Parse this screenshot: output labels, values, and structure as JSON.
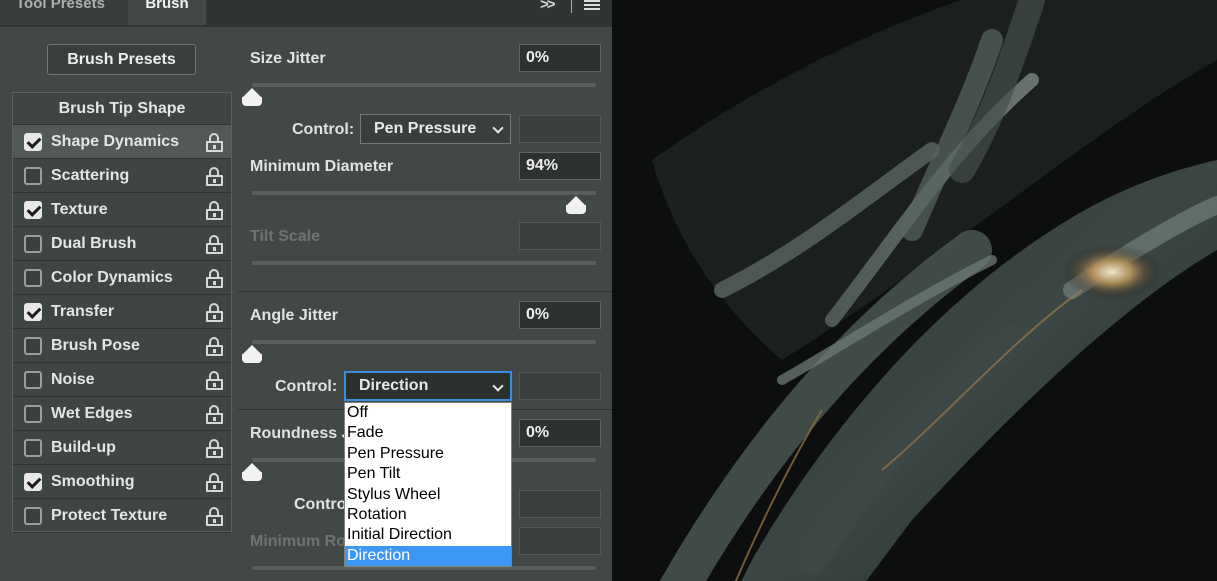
{
  "tabs": {
    "tool_presets": "Tool Presets",
    "brush": "Brush"
  },
  "panel": {
    "collapse_glyph": ">>",
    "brush_presets_label": "Brush Presets"
  },
  "sidebar": {
    "header": "Brush Tip Shape",
    "items": [
      {
        "label": "Shape Dynamics",
        "checked": true,
        "active": true
      },
      {
        "label": "Scattering",
        "checked": false
      },
      {
        "label": "Texture",
        "checked": true
      },
      {
        "label": "Dual Brush",
        "checked": false
      },
      {
        "label": "Color Dynamics",
        "checked": false
      },
      {
        "label": "Transfer",
        "checked": true
      },
      {
        "label": "Brush Pose",
        "checked": false
      },
      {
        "label": "Noise",
        "checked": false
      },
      {
        "label": "Wet Edges",
        "checked": false
      },
      {
        "label": "Build-up",
        "checked": false
      },
      {
        "label": "Smoothing",
        "checked": true
      },
      {
        "label": "Protect Texture",
        "checked": false
      }
    ]
  },
  "settings": {
    "size_jitter": {
      "label": "Size Jitter",
      "value": "0%",
      "level": 0
    },
    "size_control": {
      "label": "Control:",
      "value": "Pen Pressure"
    },
    "min_diameter": {
      "label": "Minimum Diameter",
      "value": "94%",
      "level": 0.94
    },
    "tilt_scale": {
      "label": "Tilt Scale"
    },
    "angle_jitter": {
      "label": "Angle Jitter",
      "value": "0%",
      "level": 0
    },
    "angle_control": {
      "label": "Control:",
      "value": "Direction"
    },
    "roundness_jitter": {
      "label": "Roundness J",
      "value": "0%",
      "level": 0
    },
    "roundness_control": {
      "label": "Contro"
    },
    "min_roundness": {
      "label": "Minimum Ro"
    }
  },
  "dropdown": {
    "options": [
      "Off",
      "Fade",
      "Pen Pressure",
      "Pen Tilt",
      "Stylus Wheel",
      "Rotation",
      "Initial Direction",
      "Direction"
    ],
    "selected": "Direction"
  },
  "colors": {
    "accent": "#3c97f5",
    "focus": "#3b8ede",
    "panel": "#424846"
  }
}
